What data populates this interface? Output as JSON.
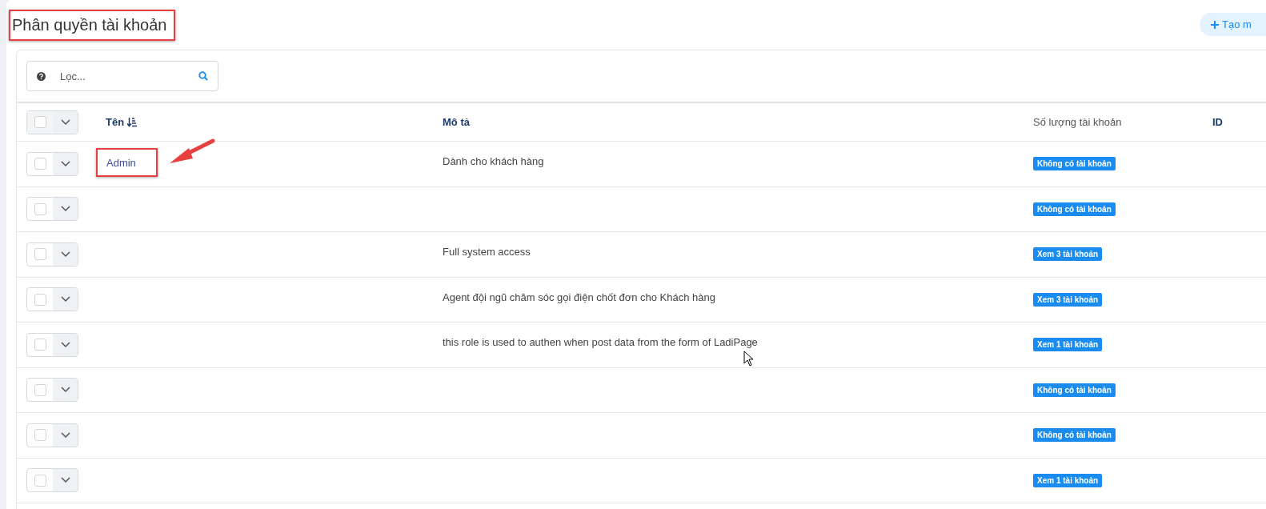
{
  "page": {
    "title": "Phân quyền tài khoản",
    "title_highlighted": true
  },
  "create_button": {
    "label": "Tạo m"
  },
  "filter": {
    "placeholder": "Lọc..."
  },
  "table": {
    "columns": [
      {
        "label": "Tên",
        "sortable": true
      },
      {
        "label": "Mô tả",
        "sortable": false
      },
      {
        "label": "Số lượng tài khoản",
        "sortable": false
      },
      {
        "label": "ID",
        "sortable": false
      }
    ],
    "header_checked": false,
    "rows": [
      {
        "checked": false,
        "name": "Admin",
        "name_highlighted": true,
        "description": "Dành cho khách hàng",
        "accounts": "Không có tài khoản"
      },
      {
        "checked": false,
        "accounts": "Không có tài khoản"
      },
      {
        "checked": false,
        "description": "Full system access",
        "accounts": "Xem 3 tài khoản"
      },
      {
        "checked": false,
        "description": "Agent đội ngũ chăm sóc gọi điện chốt đơn cho Khách hàng",
        "accounts": "Xem 3 tài khoản"
      },
      {
        "checked": false,
        "description": "this role is used to authen when post data from the form of LadiPage",
        "accounts": "Xem 1 tài khoản"
      },
      {
        "checked": false,
        "accounts": "Không có tài khoản"
      },
      {
        "checked": false,
        "accounts": "Không có tài khoản"
      },
      {
        "checked": false,
        "accounts": "Xem 1 tài khoản"
      }
    ]
  }
}
